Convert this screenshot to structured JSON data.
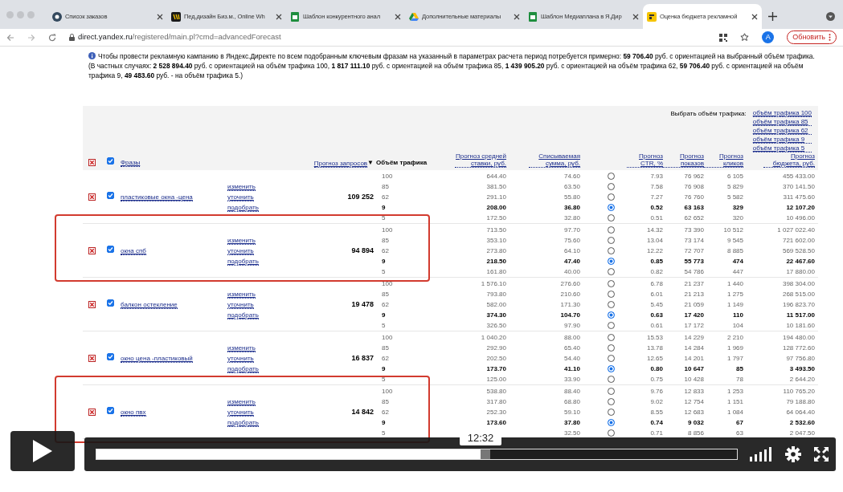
{
  "browser": {
    "tabs": [
      {
        "title": "Список заказов",
        "selected": false
      },
      {
        "title": "Пед.дизайн Биз.м., Online Wh",
        "selected": false
      },
      {
        "title": "Шаблон конкурентного анал",
        "selected": false
      },
      {
        "title": "Дополнительные материалы",
        "selected": false
      },
      {
        "title": "Шаблон Медиаплана в Я.Дир",
        "selected": false
      },
      {
        "title": "Оценка бюджета рекламной",
        "selected": true
      }
    ],
    "url_host": "direct.yandex.ru",
    "url_path": "/registered/main.pl?cmd=advancedForecast",
    "avatar": "A",
    "update_button": "Обновить"
  },
  "info": "Чтобы провести рекламную кампанию в Яндекс.Директе по всем подобранным ключевым фразам на указанный в параметрах расчета период потребуется примерно: **59 706.40** руб. с ориентацией на выбранный объём трафика. (В частных случаях: **2 528 894.40** руб. с ориентацией на объём трафика 100, **1 817 111.10** руб. с ориентацией на объём трафика 85, **1 439 905.20** руб. с ориентацией на объём трафика 62, **59 706.40** руб. с ориентацией на объём трафика 9, **49 483.60** руб. - на объём трафика 5.)",
  "traffic_picker": {
    "label": "Выбрать объём трафика:",
    "links": [
      "объём трафика 100",
      "объём трафика 85",
      "объём трафика 62",
      "объём трафика 9",
      "объём трафика 5"
    ]
  },
  "header": {
    "all_checked": true,
    "phrases": "Фразы",
    "queries": "Прогноз запросов",
    "sort_mark": "▼",
    "traffic": "Объём трафика",
    "bid": "Прогноз средней ставки, руб.",
    "sum": "Списываемая сумма, руб.",
    "ctr": "Прогноз CTR, %",
    "impressions": "Прогноз показов",
    "clicks": "Прогноз кликов",
    "budget": "Прогноз бюджета, руб."
  },
  "rows": [
    {
      "phrase": "пластиковые окна -цена",
      "checked": true,
      "highlighted": false,
      "actions": [
        "изменить",
        "уточнить",
        "подобрать"
      ],
      "queries": "109 252",
      "options": [
        {
          "traffic": "100",
          "bid": "644.40",
          "sum": "74.60",
          "selected": false,
          "ctr": "7.93",
          "impressions": "76 962",
          "clicks": "6 105",
          "budget": "455 433.00"
        },
        {
          "traffic": "85",
          "bid": "381.50",
          "sum": "63.50",
          "selected": false,
          "ctr": "7.58",
          "impressions": "76 908",
          "clicks": "5 829",
          "budget": "370 141.50"
        },
        {
          "traffic": "62",
          "bid": "291.10",
          "sum": "55.80",
          "selected": false,
          "ctr": "7.27",
          "impressions": "76 760",
          "clicks": "5 582",
          "budget": "311 475.60"
        },
        {
          "traffic": "9",
          "bid": "208.00",
          "sum": "36.80",
          "selected": true,
          "ctr": "0.52",
          "impressions": "63 163",
          "clicks": "329",
          "budget": "12 107.20"
        },
        {
          "traffic": "5",
          "bid": "172.50",
          "sum": "32.80",
          "selected": false,
          "ctr": "0.51",
          "impressions": "62 652",
          "clicks": "320",
          "budget": "10 496.00"
        }
      ]
    },
    {
      "phrase": "окна спб",
      "checked": true,
      "highlighted": true,
      "actions": [
        "изменить",
        "уточнить",
        "подобрать"
      ],
      "queries": "94 894",
      "options": [
        {
          "traffic": "100",
          "bid": "713.50",
          "sum": "97.70",
          "selected": false,
          "ctr": "14.32",
          "impressions": "73 390",
          "clicks": "10 512",
          "budget": "1 027 022.40"
        },
        {
          "traffic": "85",
          "bid": "353.10",
          "sum": "75.60",
          "selected": false,
          "ctr": "13.04",
          "impressions": "73 174",
          "clicks": "9 545",
          "budget": "721 602.00"
        },
        {
          "traffic": "62",
          "bid": "273.80",
          "sum": "64.10",
          "selected": false,
          "ctr": "12.22",
          "impressions": "72 707",
          "clicks": "8 885",
          "budget": "569 528.50"
        },
        {
          "traffic": "9",
          "bid": "218.50",
          "sum": "47.40",
          "selected": true,
          "ctr": "0.85",
          "impressions": "55 773",
          "clicks": "474",
          "budget": "22 467.60"
        },
        {
          "traffic": "5",
          "bid": "161.80",
          "sum": "40.00",
          "selected": false,
          "ctr": "0.82",
          "impressions": "54 786",
          "clicks": "447",
          "budget": "17 880.00"
        }
      ]
    },
    {
      "phrase": "балкон остекление",
      "checked": true,
      "highlighted": false,
      "actions": [
        "изменить",
        "уточнить",
        "подобрать"
      ],
      "queries": "19 478",
      "options": [
        {
          "traffic": "100",
          "bid": "1 576.10",
          "sum": "276.60",
          "selected": false,
          "ctr": "6.78",
          "impressions": "21 237",
          "clicks": "1 440",
          "budget": "398 304.00"
        },
        {
          "traffic": "85",
          "bid": "793.80",
          "sum": "210.60",
          "selected": false,
          "ctr": "6.01",
          "impressions": "21 213",
          "clicks": "1 275",
          "budget": "268 515.00"
        },
        {
          "traffic": "62",
          "bid": "582.00",
          "sum": "171.30",
          "selected": false,
          "ctr": "5.45",
          "impressions": "21 059",
          "clicks": "1 149",
          "budget": "196 823.70"
        },
        {
          "traffic": "9",
          "bid": "374.30",
          "sum": "104.70",
          "selected": true,
          "ctr": "0.63",
          "impressions": "17 420",
          "clicks": "110",
          "budget": "11 517.00"
        },
        {
          "traffic": "5",
          "bid": "326.50",
          "sum": "97.90",
          "selected": false,
          "ctr": "0.61",
          "impressions": "17 172",
          "clicks": "104",
          "budget": "10 181.60"
        }
      ]
    },
    {
      "phrase": "окно цена -пластиковый",
      "checked": true,
      "highlighted": false,
      "actions": [
        "изменить",
        "уточнить",
        "подобрать"
      ],
      "queries": "16 837",
      "options": [
        {
          "traffic": "100",
          "bid": "1 040.20",
          "sum": "88.00",
          "selected": false,
          "ctr": "15.53",
          "impressions": "14 229",
          "clicks": "2 210",
          "budget": "194 480.00"
        },
        {
          "traffic": "85",
          "bid": "292.90",
          "sum": "65.40",
          "selected": false,
          "ctr": "13.78",
          "impressions": "14 284",
          "clicks": "1 969",
          "budget": "128 772.60"
        },
        {
          "traffic": "62",
          "bid": "202.50",
          "sum": "54.40",
          "selected": false,
          "ctr": "12.65",
          "impressions": "14 201",
          "clicks": "1 797",
          "budget": "97 756.80"
        },
        {
          "traffic": "9",
          "bid": "173.70",
          "sum": "41.10",
          "selected": true,
          "ctr": "0.80",
          "impressions": "10 647",
          "clicks": "85",
          "budget": "3 493.50"
        },
        {
          "traffic": "5",
          "bid": "125.00",
          "sum": "33.90",
          "selected": false,
          "ctr": "0.75",
          "impressions": "10 428",
          "clicks": "78",
          "budget": "2 644.20"
        }
      ]
    },
    {
      "phrase": "окно пвх",
      "checked": true,
      "highlighted": true,
      "actions": [
        "изменить",
        "уточнить",
        "подобрать"
      ],
      "queries": "14 842",
      "options": [
        {
          "traffic": "100",
          "bid": "538.80",
          "sum": "88.40",
          "selected": false,
          "ctr": "9.76",
          "impressions": "12 833",
          "clicks": "1 253",
          "budget": "110 765.20"
        },
        {
          "traffic": "85",
          "bid": "317.80",
          "sum": "68.80",
          "selected": false,
          "ctr": "9.02",
          "impressions": "12 754",
          "clicks": "1 151",
          "budget": "79 188.80"
        },
        {
          "traffic": "62",
          "bid": "252.30",
          "sum": "59.10",
          "selected": false,
          "ctr": "8.55",
          "impressions": "12 683",
          "clicks": "1 084",
          "budget": "64 064.40"
        },
        {
          "traffic": "9",
          "bid": "173.60",
          "sum": "37.80",
          "selected": true,
          "ctr": "0.74",
          "impressions": "9 032",
          "clicks": "67",
          "budget": "2 532.60"
        },
        {
          "traffic": "5",
          "sum": "32.50",
          "selected": false,
          "ctr": "0.71",
          "impressions": "8 856",
          "clicks": "63",
          "budget": "2 047.50"
        }
      ]
    }
  ],
  "player": {
    "time": "12:32",
    "level": 0.6
  }
}
